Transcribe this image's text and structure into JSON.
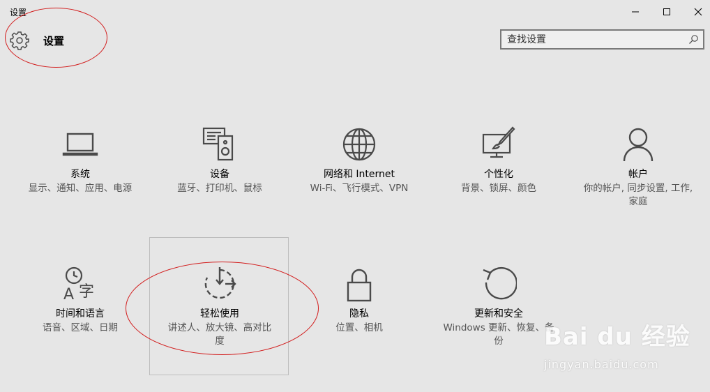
{
  "window": {
    "title": "设置"
  },
  "header": {
    "title": "设置"
  },
  "search": {
    "placeholder": "查找设置"
  },
  "tiles": [
    {
      "name": "系统",
      "desc": "显示、通知、应用、电源",
      "icon": "laptop-icon"
    },
    {
      "name": "设备",
      "desc": "蓝牙、打印机、鼠标",
      "icon": "devices-icon"
    },
    {
      "name": "网络和 Internet",
      "desc": "Wi-Fi、飞行模式、VPN",
      "icon": "globe-icon"
    },
    {
      "name": "个性化",
      "desc": "背景、锁屏、颜色",
      "icon": "personalization-icon"
    },
    {
      "name": "帐户",
      "desc": "你的帐户, 同步设置, 工作, 家庭",
      "icon": "person-icon"
    },
    {
      "name": "时间和语言",
      "desc": "语音、区域、日期",
      "icon": "time-language-icon"
    },
    {
      "name": "轻松使用",
      "desc": "讲述人、放大镜、高对比度",
      "icon": "ease-of-access-icon"
    },
    {
      "name": "隐私",
      "desc": "位置、相机",
      "icon": "lock-icon"
    },
    {
      "name": "更新和安全",
      "desc": "Windows 更新、恢复、备份",
      "icon": "refresh-icon"
    }
  ],
  "watermark": {
    "logo": "Bai du 经验",
    "url": "jingyan.baidu.com"
  },
  "colors": {
    "background": "#e6e6e6",
    "icon": "#4a4a4a",
    "annotation": "#d21b1b"
  }
}
